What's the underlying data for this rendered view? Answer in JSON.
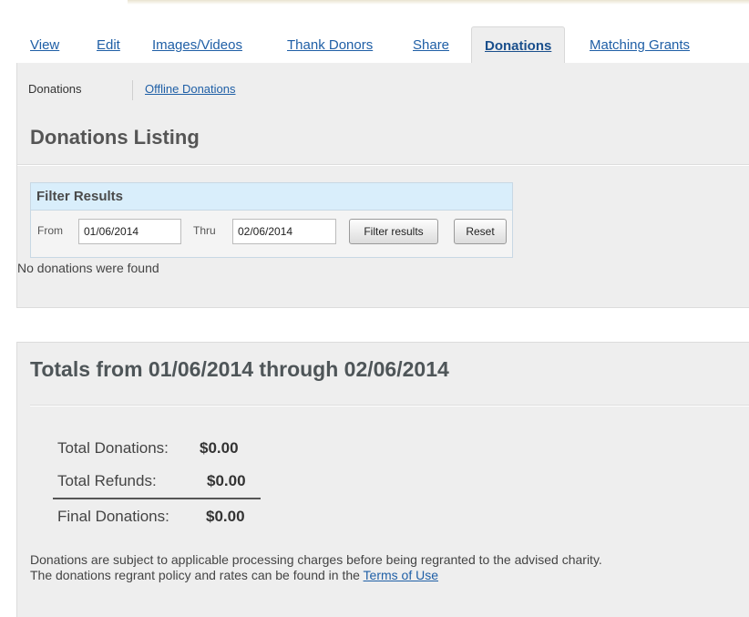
{
  "tabs": [
    {
      "label": "View",
      "active": false
    },
    {
      "label": "Edit",
      "active": false
    },
    {
      "label": "Images/Videos",
      "active": false
    },
    {
      "label": "Thank Donors",
      "active": false
    },
    {
      "label": "Share",
      "active": false
    },
    {
      "label": "Donations",
      "active": true
    },
    {
      "label": "Matching Grants",
      "active": false
    }
  ],
  "subnav": {
    "current": "Donations",
    "link": "Offline Donations"
  },
  "listing_title": "Donations Listing",
  "filter": {
    "header": "Filter Results",
    "from_label": "From",
    "from_value": "01/06/2014",
    "thru_label": "Thru",
    "thru_value": "02/06/2014",
    "filter_button": "Filter results",
    "reset_button": "Reset"
  },
  "empty_message": "No donations were found",
  "totals": {
    "title": "Totals from 01/06/2014 through 02/06/2014",
    "rows": [
      {
        "label": "Total Donations:",
        "value": "$0.00"
      },
      {
        "label": "Total Refunds:",
        "value": "$0.00"
      },
      {
        "label": "Final Donations:",
        "value": "$0.00"
      }
    ]
  },
  "note": {
    "line1": "Donations are subject to applicable processing charges before being regranted to the advised charity.",
    "line2_prefix": "The donations regrant policy and rates can be found in the ",
    "link": "Terms of Use"
  }
}
